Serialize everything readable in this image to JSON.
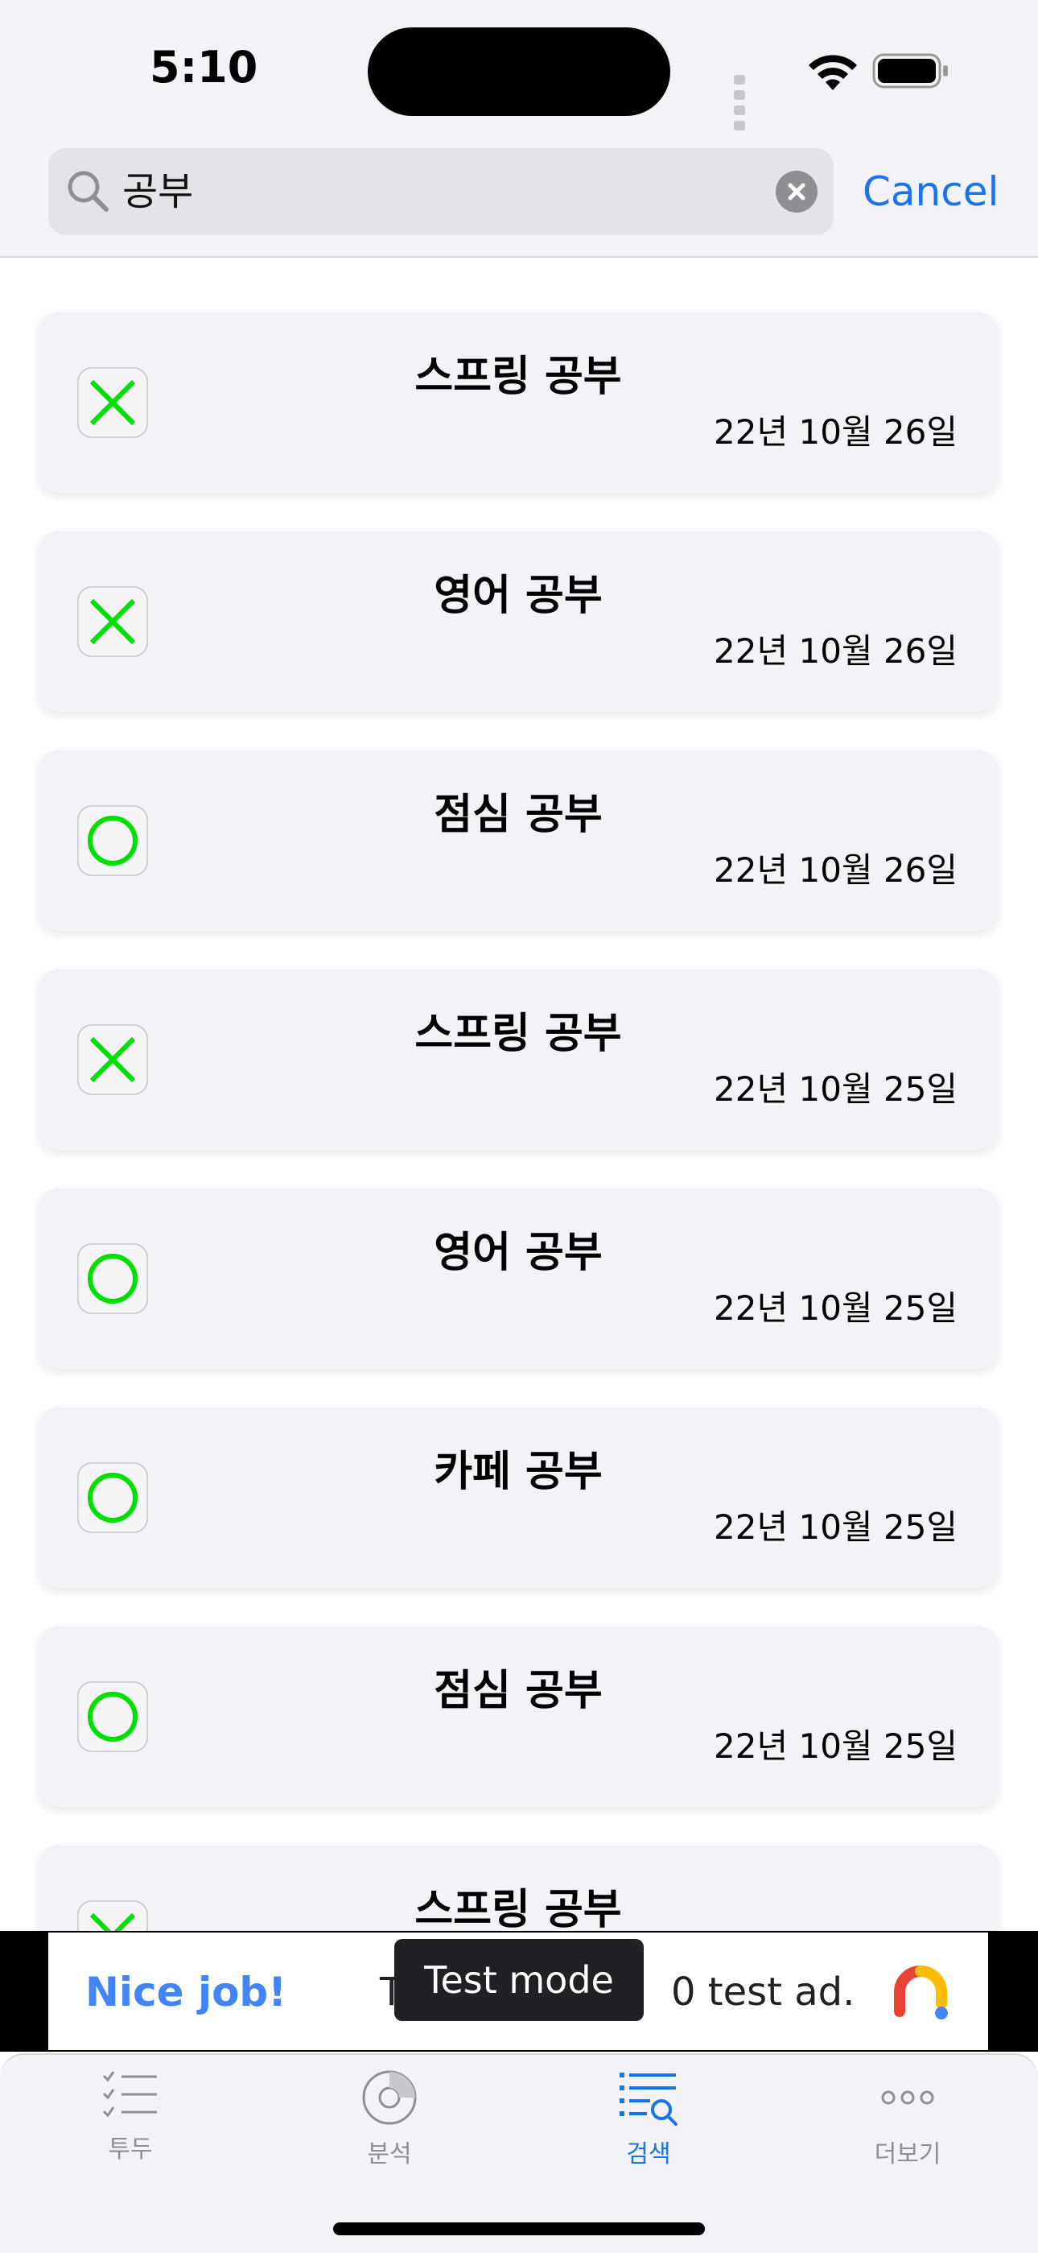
{
  "status_bar": {
    "time": "5:10"
  },
  "search": {
    "query": "공부",
    "cancel_label": "Cancel"
  },
  "todos": [
    {
      "title": "스프링 공부",
      "date": "22년 10월 26일",
      "state": "x"
    },
    {
      "title": "영어 공부",
      "date": "22년 10월 26일",
      "state": "x"
    },
    {
      "title": "점심 공부",
      "date": "22년 10월 26일",
      "state": "o"
    },
    {
      "title": "스프링 공부",
      "date": "22년 10월 25일",
      "state": "x"
    },
    {
      "title": "영어 공부",
      "date": "22년 10월 25일",
      "state": "o"
    },
    {
      "title": "카페 공부",
      "date": "22년 10월 25일",
      "state": "o"
    },
    {
      "title": "점심 공부",
      "date": "22년 10월 25일",
      "state": "o"
    },
    {
      "title": "스프링 공부",
      "date": "",
      "state": "x"
    }
  ],
  "ad": {
    "nice_job": "Nice job!",
    "text_left": "T",
    "text_right": "0 test ad.",
    "test_mode": "Test mode"
  },
  "tabs": [
    {
      "label": "투두",
      "icon": "checklist-icon",
      "active": false
    },
    {
      "label": "분석",
      "icon": "chart-icon",
      "active": false
    },
    {
      "label": "검색",
      "icon": "search-list-icon",
      "active": true
    },
    {
      "label": "더보기",
      "icon": "more-icon",
      "active": false
    }
  ],
  "colors": {
    "accent": "#1a73e8",
    "check_green": "#00e000",
    "ad_blue": "#4285f4"
  }
}
